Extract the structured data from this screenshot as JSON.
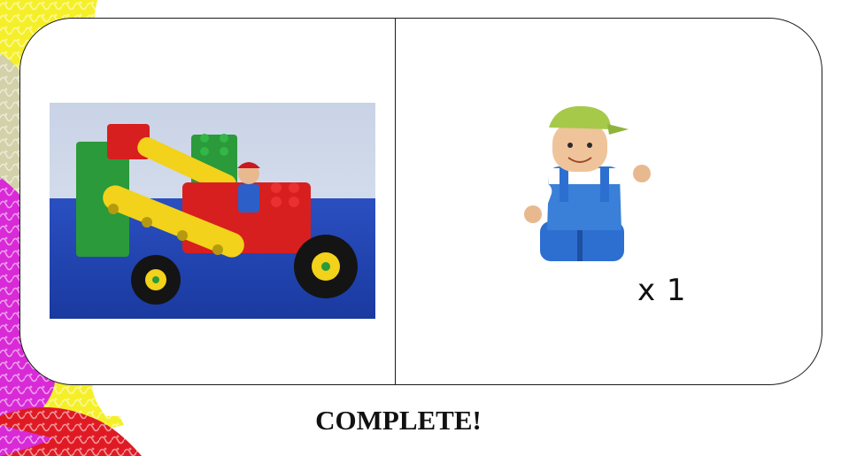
{
  "instruction_card": {
    "build_step": {
      "image_icon": "lego-duplo-vehicle-photo"
    },
    "part": {
      "image_icon": "lego-duplo-boy-figure",
      "quantity_label": "x 1"
    }
  },
  "footer": {
    "status_text": "COMPLETE!"
  },
  "colors": {
    "decor_yellow": "#f5ef2a",
    "decor_magenta": "#d82ad6",
    "decor_red": "#e01a24",
    "lego_red": "#d81f1f",
    "lego_green": "#2a9a3a",
    "lego_yellow": "#f2d21a",
    "lego_blue": "#2d5fc8",
    "cap_green": "#a6c94a"
  }
}
